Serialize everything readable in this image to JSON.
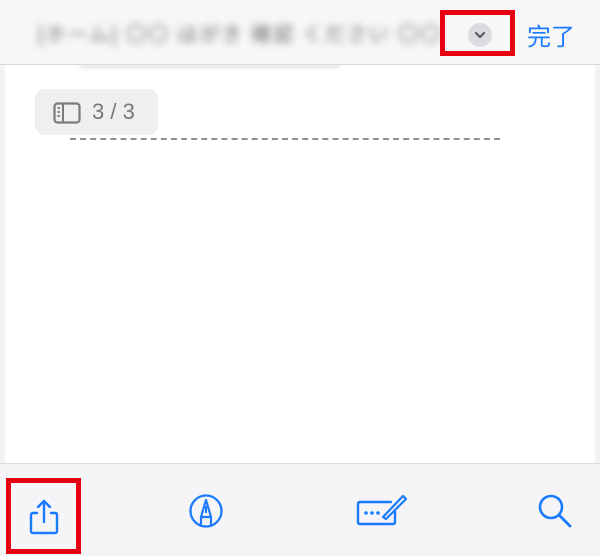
{
  "nav": {
    "title": "[ホーム] 〇〇 はがき 確認 ください 〇〇",
    "collapse_icon": "chevron-down-icon",
    "done_label": "完了"
  },
  "document": {
    "page_indicator": {
      "icon": "sidebar-icon",
      "text": "3 / 3"
    }
  },
  "toolbar": {
    "items": [
      {
        "icon": "share-icon",
        "highlighted": true
      },
      {
        "icon": "markup-pen-icon"
      },
      {
        "icon": "signature-keyboard-icon"
      },
      {
        "icon": "search-icon"
      }
    ]
  },
  "colors": {
    "accent": "#1a7bff",
    "highlight_box": "#e60012"
  }
}
